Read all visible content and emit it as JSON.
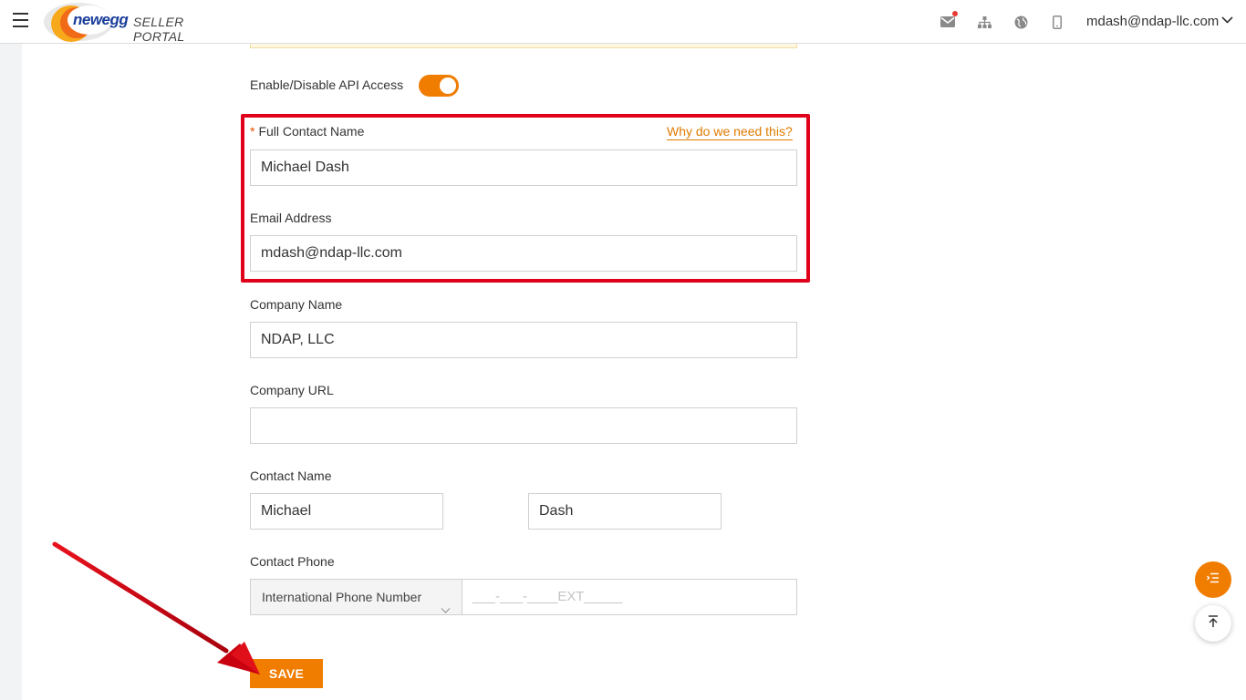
{
  "header": {
    "brand": "newegg",
    "portal_label": "SELLER PORTAL",
    "icons": [
      "menu-icon",
      "mail-icon",
      "sitemap-icon",
      "globe-icon",
      "mobile-icon"
    ],
    "user_email": "mdash@ndap-llc.com"
  },
  "form": {
    "api_access_label": "Enable/Disable API Access",
    "api_access_enabled": true,
    "full_contact_name": {
      "required_mark": "*",
      "label": "Full Contact Name",
      "help_link": "Why do we need this?",
      "value": "Michael Dash"
    },
    "email": {
      "label": "Email Address",
      "value": "mdash@ndap-llc.com"
    },
    "company_name": {
      "label": "Company Name",
      "value": "NDAP, LLC"
    },
    "company_url": {
      "label": "Company URL",
      "value": ""
    },
    "contact_name": {
      "label": "Contact Name",
      "first": "Michael",
      "last": "Dash"
    },
    "contact_phone": {
      "label": "Contact Phone",
      "country_select": "International Phone Number",
      "placeholder": "___-___-____EXT_____"
    },
    "save_label": "SAVE"
  },
  "colors": {
    "accent": "#f07c00",
    "highlight": "#e0001b",
    "link": "#e07b00"
  }
}
